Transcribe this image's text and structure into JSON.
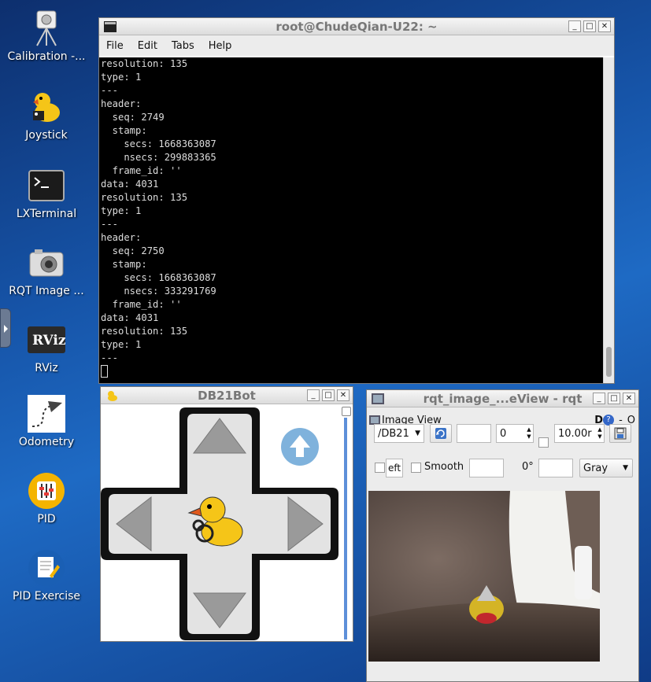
{
  "desktop": {
    "icons": [
      {
        "label": "Calibration -...",
        "icon": "calibration-icon"
      },
      {
        "label": "Joystick",
        "icon": "duck-joystick-icon"
      },
      {
        "label": "LXTerminal",
        "icon": "terminal-icon"
      },
      {
        "label": "RQT Image ...",
        "icon": "camera-icon"
      },
      {
        "label": "RViz",
        "icon": "rviz-icon"
      },
      {
        "label": "Odometry",
        "icon": "odometry-icon"
      },
      {
        "label": "PID",
        "icon": "pid-icon"
      },
      {
        "label": "PID Exercise",
        "icon": "pid-exercise-icon"
      }
    ]
  },
  "terminal": {
    "title": "root@ChudeQian-U22: ~",
    "menu": [
      "File",
      "Edit",
      "Tabs",
      "Help"
    ],
    "lines": [
      "resolution: 135",
      "type: 1",
      "---",
      "header:",
      "  seq: 2749",
      "  stamp:",
      "    secs: 1668363087",
      "    nsecs: 299883365",
      "  frame_id: ''",
      "data: 4031",
      "resolution: 135",
      "type: 1",
      "---",
      "header:",
      "  seq: 2750",
      "  stamp:",
      "    secs: 1668363087",
      "    nsecs: 333291769",
      "  frame_id: ''",
      "data: 4031",
      "resolution: 135",
      "type: 1",
      "---"
    ]
  },
  "joystick": {
    "title": "DB21Bot"
  },
  "rqt": {
    "title": "rqt_image_...eView - rqt",
    "plugin_label": "Image View",
    "plugin_buttons": [
      "D",
      "?",
      "-",
      "O"
    ],
    "topic": "/DB21",
    "value": "0",
    "max_value": "10.00r",
    "left_label": "eft",
    "smooth_label": "Smooth",
    "rotation": "0°",
    "colormap": "Gray"
  }
}
